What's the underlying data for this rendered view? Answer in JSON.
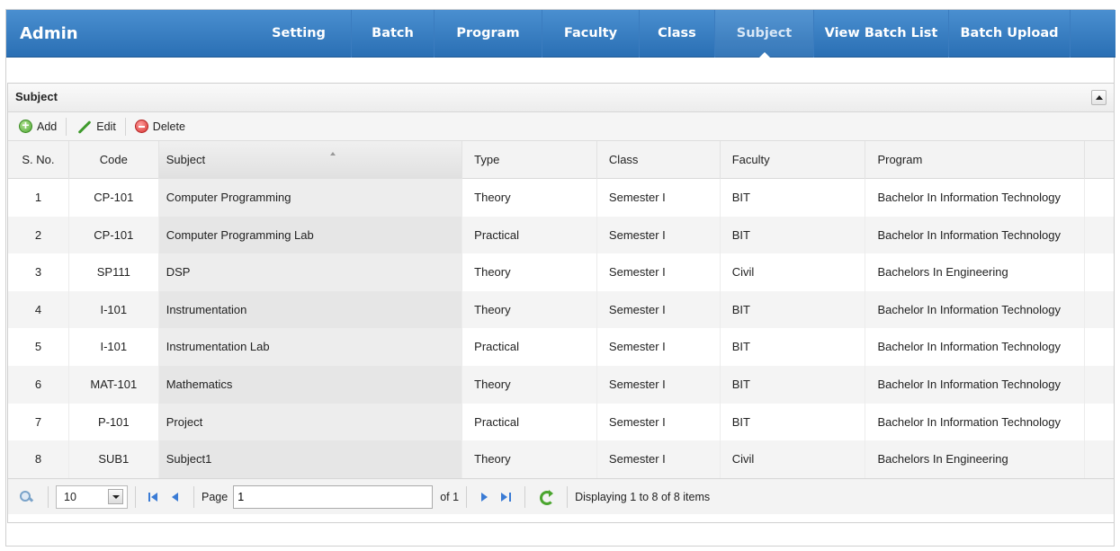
{
  "nav": {
    "brand": "Admin",
    "items": [
      {
        "label": "Setting",
        "name": "nav-setting",
        "width": 117
      },
      {
        "label": "Batch",
        "name": "nav-batch",
        "width": 92
      },
      {
        "label": "Program",
        "name": "nav-program",
        "width": 120
      },
      {
        "label": "Faculty",
        "name": "nav-faculty",
        "width": 108
      },
      {
        "label": "Class",
        "name": "nav-class",
        "width": 84
      },
      {
        "label": "Subject",
        "name": "nav-subject",
        "width": 110
      },
      {
        "label": "View Batch List",
        "name": "nav-view-batch-list",
        "width": 150
      },
      {
        "label": "Batch Upload",
        "name": "nav-batch-upload",
        "width": 135
      }
    ],
    "active": "Subject"
  },
  "panel": {
    "title": "Subject",
    "toolbar": {
      "add": "Add",
      "edit": "Edit",
      "delete": "Delete"
    }
  },
  "grid": {
    "columns": [
      "S. No.",
      "Code",
      "Subject",
      "Type",
      "Class",
      "Faculty",
      "Program"
    ],
    "rows": [
      [
        "1",
        "CP-101",
        "Computer Programming",
        "Theory",
        "Semester I",
        "BIT",
        "Bachelor In Information Technology"
      ],
      [
        "2",
        "CP-101",
        "Computer Programming Lab",
        "Practical",
        "Semester I",
        "BIT",
        "Bachelor In Information Technology"
      ],
      [
        "3",
        "SP111",
        "DSP",
        "Theory",
        "Semester I",
        "Civil",
        "Bachelors In Engineering"
      ],
      [
        "4",
        "I-101",
        "Instrumentation",
        "Theory",
        "Semester I",
        "BIT",
        "Bachelor In Information Technology"
      ],
      [
        "5",
        "I-101",
        "Instrumentation Lab",
        "Practical",
        "Semester I",
        "BIT",
        "Bachelor In Information Technology"
      ],
      [
        "6",
        "MAT-101",
        "Mathematics",
        "Theory",
        "Semester I",
        "BIT",
        "Bachelor In Information Technology"
      ],
      [
        "7",
        "P-101",
        "Project",
        "Practical",
        "Semester I",
        "BIT",
        "Bachelor In Information Technology"
      ],
      [
        "8",
        "SUB1",
        "Subject1",
        "Theory",
        "Semester I",
        "Civil",
        "Bachelors In Engineering"
      ]
    ]
  },
  "pager": {
    "page_size": "10",
    "page_label": "Page",
    "page_value": "1",
    "of_label": "of 1",
    "display_text": "Displaying 1 to 8 of 8 items"
  }
}
